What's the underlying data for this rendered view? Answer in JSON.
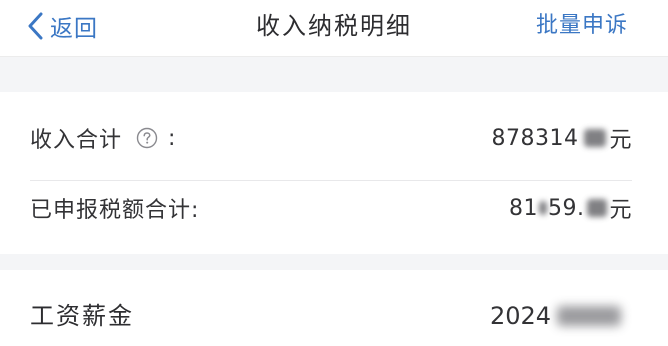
{
  "nav": {
    "back_label": "返回",
    "title": "收入纳税明细",
    "action_label": "批量申诉"
  },
  "summary": {
    "income": {
      "label": "收入合计",
      "colon": ":",
      "value_prefix": "878314",
      "unit": "元"
    },
    "tax": {
      "label": "已申报税额合计:",
      "value_prefix": "81",
      "value_middle": "59.",
      "unit": "元"
    }
  },
  "category": {
    "label": "工资薪金",
    "year_prefix": "2024"
  },
  "colors": {
    "accent": "#3b77c4",
    "background": "#f4f5f7",
    "card": "#ffffff",
    "text": "#333336",
    "divider": "#e8e8ea"
  },
  "icons": {
    "back": "chevron-left-icon",
    "help": "question-circle-icon"
  }
}
